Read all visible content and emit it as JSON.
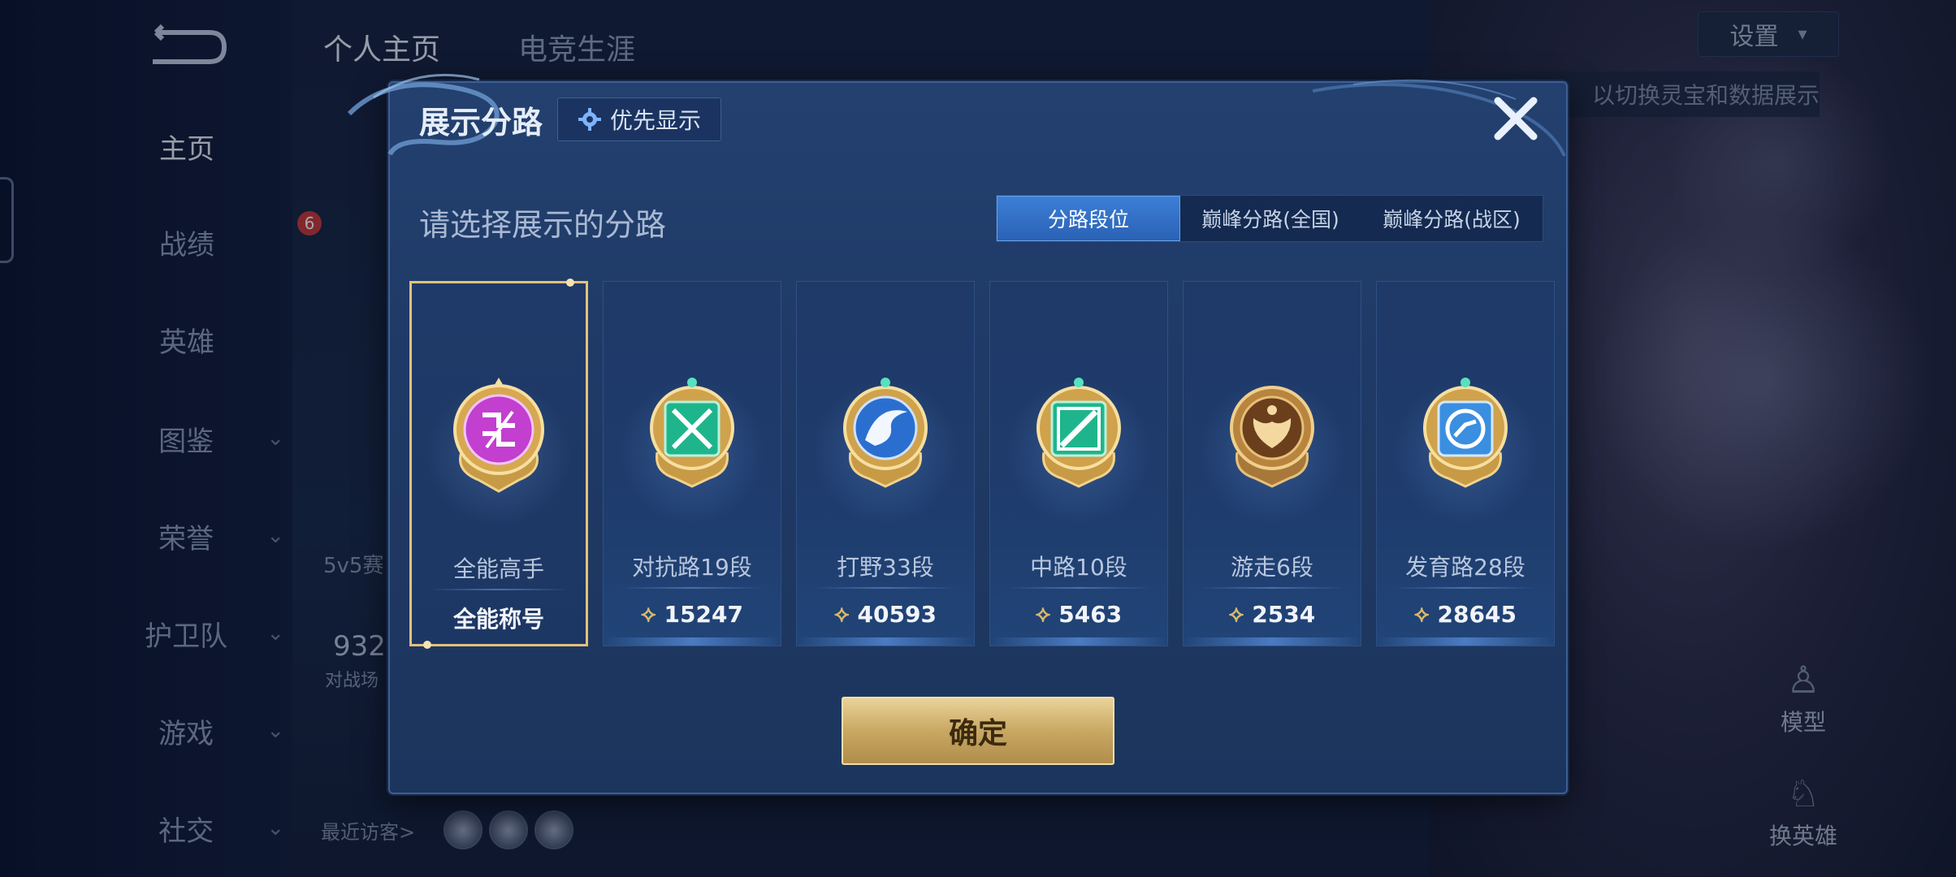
{
  "top_tabs": [
    "个人主页",
    "电竞生涯"
  ],
  "side_nav": [
    {
      "label": "主页",
      "chevron": false,
      "active": true
    },
    {
      "label": "战绩",
      "chevron": false
    },
    {
      "label": "英雄",
      "chevron": false
    },
    {
      "label": "图鉴",
      "chevron": true
    },
    {
      "label": "荣誉",
      "chevron": true
    },
    {
      "label": "护卫队",
      "chevron": true
    },
    {
      "label": "游戏",
      "chevron": true
    },
    {
      "label": "社交",
      "chevron": true
    }
  ],
  "header_right": {
    "settings_label": "设置",
    "hint_text": "以切换灵宝和数据展示",
    "model_label": "模型",
    "switch_hero_label": "换英雄"
  },
  "profile_peek": {
    "badge_count": "6",
    "mode_label": "5v5赛",
    "number_partial": "932",
    "sub_partial": "对战场",
    "visitors_label": "最近访客>"
  },
  "modal": {
    "title": "展示分路",
    "priority_label": "优先显示",
    "subtitle": "请选择展示的分路",
    "segments": [
      "分路段位",
      "巅峰分路(全国)",
      "巅峰分路(战区)"
    ],
    "active_segment": 0,
    "cards": [
      {
        "name": "全能高手",
        "value": "全能称号",
        "icon": "all-round-emblem-icon",
        "gem": "#c23fd0",
        "selected": true
      },
      {
        "name": "对抗路19段",
        "value": "15247",
        "icon": "clash-lane-emblem-icon",
        "gem": "#1fb58c"
      },
      {
        "name": "打野33段",
        "value": "40593",
        "icon": "jungle-emblem-icon",
        "gem": "#2a6fd0"
      },
      {
        "name": "中路10段",
        "value": "5463",
        "icon": "mid-lane-emblem-icon",
        "gem": "#1fb58c"
      },
      {
        "name": "游走6段",
        "value": "2534",
        "icon": "roam-emblem-icon",
        "gem": "#b07a30"
      },
      {
        "name": "发育路28段",
        "value": "28645",
        "icon": "farm-lane-emblem-icon",
        "gem": "#3a8fe0"
      }
    ],
    "confirm_label": "确定"
  }
}
